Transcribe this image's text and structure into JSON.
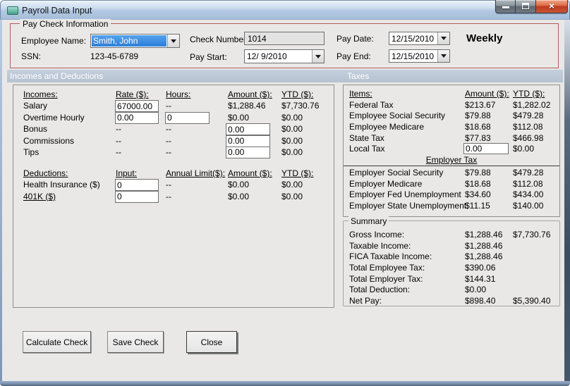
{
  "window": {
    "title": "Payroll Data Input"
  },
  "paycheck": {
    "group_label": "Pay Check Information",
    "employee_label": "Employee Name:",
    "employee_value": "Smith, John",
    "ssn_label": "SSN:",
    "ssn_value": "123-45-6789",
    "check_number_label": "Check Number:",
    "check_number_value": "1014",
    "pay_start_label": "Pay Start:",
    "pay_start_value": "12/ 9/2010",
    "pay_date_label": "Pay Date:",
    "pay_date_value": "12/15/2010",
    "pay_end_label": "Pay End:",
    "pay_end_value": "12/15/2010",
    "frequency": "Weekly"
  },
  "section_headers": {
    "left": "Incomes and Deductions",
    "right": "Taxes"
  },
  "incomes": {
    "headers": {
      "c1": "Incomes:",
      "c2": "Rate ($):",
      "c3": "Hours:",
      "c4": "Amount ($):",
      "c5": "YTD ($):"
    },
    "rows": [
      {
        "label": "Salary",
        "rate": "67000.00",
        "hours": "--",
        "amount": "$1,288.46",
        "ytd": "$7,730.76"
      },
      {
        "label": "Overtime Hourly",
        "rate": "0.00",
        "hours": "0",
        "amount": "$0.00",
        "ytd": "$0.00"
      },
      {
        "label": "Bonus",
        "rate": "--",
        "hours": "--",
        "amount": "0.00",
        "ytd": "$0.00"
      },
      {
        "label": "Commissions",
        "rate": "--",
        "hours": "--",
        "amount": "0.00",
        "ytd": "$0.00"
      },
      {
        "label": "Tips",
        "rate": "--",
        "hours": "--",
        "amount": "0.00",
        "ytd": "$0.00"
      }
    ]
  },
  "deductions": {
    "headers": {
      "c1": "Deductions:",
      "c2": "Input:",
      "c3": "Annual Limit($):",
      "c4": "Amount ($):",
      "c5": "YTD ($):"
    },
    "rows": [
      {
        "label": "Health Insurance ($)",
        "input": "0",
        "limit": "--",
        "amount": "$0.00",
        "ytd": "$0.00"
      },
      {
        "label": "401K ($)",
        "input": "0",
        "limit": "--",
        "amount": "$0.00",
        "ytd": "$0.00"
      }
    ]
  },
  "taxes": {
    "headers": {
      "c1": "Items:",
      "c2": "Amount ($):",
      "c3": "YTD ($):"
    },
    "employee_rows": [
      {
        "label": "Federal Tax",
        "amount": "$213.67",
        "ytd": "$1,282.02"
      },
      {
        "label": "Employee Social Security",
        "amount": "$79.88",
        "ytd": "$479.28"
      },
      {
        "label": "Employee Medicare",
        "amount": "$18.68",
        "ytd": "$112.08"
      },
      {
        "label": "State Tax",
        "amount": "$77.83",
        "ytd": "$466.98"
      },
      {
        "label": "Local Tax",
        "amount": "0.00",
        "ytd": "$0.00"
      }
    ],
    "divider_label": "Employer Tax",
    "employer_rows": [
      {
        "label": "Employer Social Security",
        "amount": "$79.88",
        "ytd": "$479.28"
      },
      {
        "label": "Employer Medicare",
        "amount": "$18.68",
        "ytd": "$112.08"
      },
      {
        "label": "Employer Fed Unemployment",
        "amount": "$34.60",
        "ytd": "$434.00"
      },
      {
        "label": "Employer State Unemployment",
        "amount": "$11.15",
        "ytd": "$140.00"
      }
    ]
  },
  "summary": {
    "group_label": "Summary",
    "rows": [
      {
        "label": "Gross Income:",
        "amount": "$1,288.46",
        "ytd": "$7,730.76"
      },
      {
        "label": "Taxable Income:",
        "amount": "$1,288.46",
        "ytd": ""
      },
      {
        "label": "FICA Taxable Income:",
        "amount": "$1,288.46",
        "ytd": ""
      },
      {
        "label": "Total Employee Tax:",
        "amount": "$390.06",
        "ytd": ""
      },
      {
        "label": "Total Employer Tax:",
        "amount": "$144.31",
        "ytd": ""
      },
      {
        "label": "Total Deduction:",
        "amount": "$0.00",
        "ytd": ""
      },
      {
        "label": "Net Pay:",
        "amount": "$898.40",
        "ytd": "$5,390.40"
      }
    ]
  },
  "buttons": {
    "calculate": "Calculate Check",
    "save": "Save Check",
    "close": "Close"
  },
  "colors": {
    "selection_blue": "#2F8BE4",
    "group_border_red": "#B25B5B",
    "section_bar_blue": "#BCC8D6",
    "close_button_red": "#C24B33",
    "client_background": "#E9E8E6"
  }
}
